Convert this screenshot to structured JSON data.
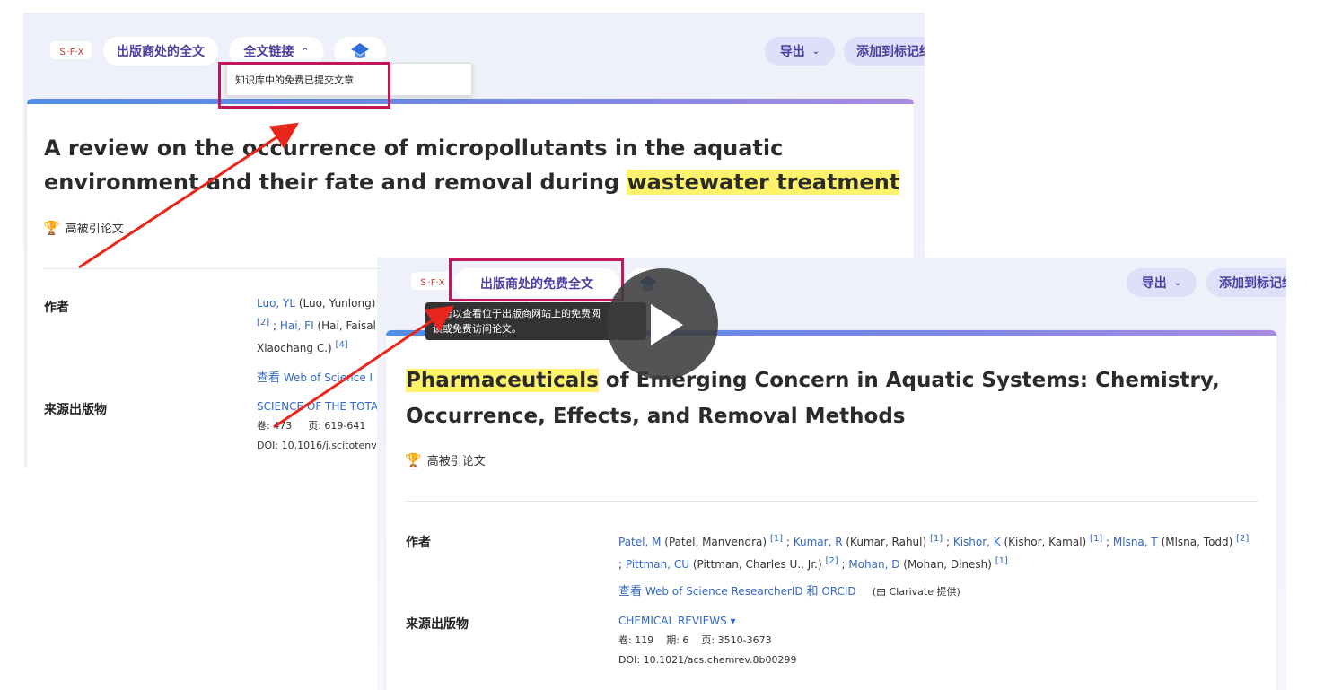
{
  "colors": {
    "accent": "#4b3fa0",
    "highlight": "#fff36b",
    "annotation_red": "#e8261c",
    "box_color": "#c2185b",
    "link": "#3368c6"
  },
  "sfx_logo": "Ｓ·F·X",
  "panel1": {
    "btn_publisher_full_text": "出版商处的全文",
    "btn_full_text_links": "全文链接",
    "dropdown_chevron": "⌃",
    "dropdown_item": "知识库中的免费已提交文章",
    "btn_export": "导出",
    "btn_add_marked": "添加到标记结果列表",
    "title_line1": "A review on the occurrence of micropollutants in the aquatic",
    "title_line2_pre": "environment and their fate and removal during ",
    "title_highlight": "wastewater treatment",
    "badge": "高被引论文",
    "authors_label": "作者",
    "author_line1_link": "Luo, YL",
    "author_line1_text": " (Luo, Yunlong)",
    "author_line2_ref": "[2]",
    "author_line2_sep": " ; ",
    "author_line2_link": "Hai, FI",
    "author_line2_text": " (Hai, Faisal",
    "author_line3_text": "Xiaochang C.) ",
    "author_line3_ref": "[4]",
    "view_researcher": "查看",
    "view_researcher_link": " Web of Science I",
    "source_label": "来源出版物",
    "journal": "SCIENCE OF THE TOTA",
    "volume": "卷: 473",
    "pages": "页: 619-641",
    "doi": "DOI: 10.1016/j.scitotenv.2"
  },
  "panel2": {
    "btn_publisher_free_text": "出版商处的免费全文",
    "tooltip_line1": "单击以查看位于出版商网站上的免费阅",
    "tooltip_line2": "读或免费访问论文。",
    "btn_export": "导出",
    "btn_add_marked": "添加到标记结果列表",
    "title_highlight": "Pharmaceuticals",
    "title_line1_post": " of Emerging Concern in Aquatic Systems: Chemistry,",
    "title_line2": "Occurrence, Effects, and Removal Methods",
    "badge": "高被引论文",
    "authors_label": "作者",
    "authors": [
      {
        "link": "Patel, M",
        "name": " (Patel, Manvendra) ",
        "ref": "[1]",
        "sep": " ; "
      },
      {
        "link": "Kumar, R",
        "name": " (Kumar, Rahul) ",
        "ref": "[1]",
        "sep": " ; "
      },
      {
        "link": "Kishor, K",
        "name": " (Kishor, Kamal) ",
        "ref": "[1]",
        "sep": " ; "
      },
      {
        "link": "Mlsna, T",
        "name": " (Mlsna, Todd) ",
        "ref": "[2]",
        "sep": ""
      }
    ],
    "authors_line2": [
      {
        "link": "Pittman, CU",
        "name": " (Pittman, Charles U., Jr.) ",
        "ref": "[2]",
        "sep": " ; "
      },
      {
        "link": "Mohan, D",
        "name": " (Mohan, Dinesh) ",
        "ref": "[1]",
        "sep": ""
      }
    ],
    "view_text": "查看",
    "view_link1": " Web of Science ResearcherID ",
    "view_and": "和",
    "view_link2": " ORCID",
    "provided_by": "(由 Clarivate 提供)",
    "source_label": "来源出版物",
    "journal": "CHEMICAL REVIEWS",
    "journal_caret": "▾",
    "volume": "卷: 119",
    "issue": "期: 6",
    "pages": "页: 3510-3673",
    "doi": "DOI: 10.1021/acs.chemrev.8b00299"
  },
  "video": {
    "play_icon": "play-icon"
  }
}
